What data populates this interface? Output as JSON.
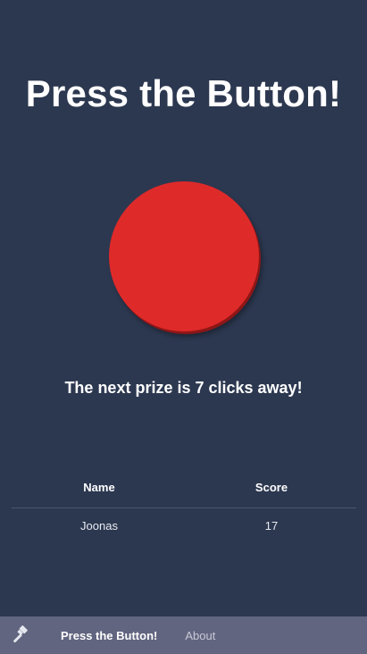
{
  "app": {
    "title": "Press the Button!",
    "prize_message": "The next prize is 7 clicks away!"
  },
  "button": {
    "color": "#df2a2a"
  },
  "leaderboard": {
    "headers": [
      "Name",
      "Score"
    ],
    "rows": [
      {
        "name": "Joonas",
        "score": "17"
      }
    ]
  },
  "footer_nav": {
    "icon": "gavel-icon",
    "items": [
      {
        "label": "Press the Button!",
        "active": true
      },
      {
        "label": "About",
        "active": false
      }
    ]
  },
  "colors": {
    "background": "#2c3850",
    "footer": "#62657f"
  }
}
